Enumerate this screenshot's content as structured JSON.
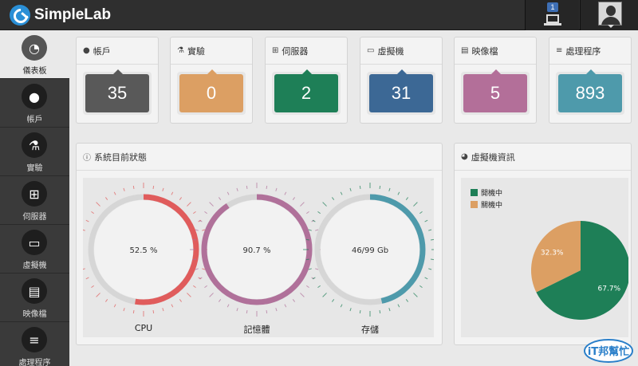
{
  "app": {
    "name": "SimpleLab"
  },
  "topbar": {
    "notification_count": "1",
    "vm_icon": "laptop-icon",
    "user_icon": "user-avatar"
  },
  "sidebar": {
    "items": [
      {
        "label": "儀表板",
        "icon": "dashboard-icon",
        "glyph": "◔",
        "active": true
      },
      {
        "label": "帳戶",
        "icon": "user-icon",
        "glyph": "●"
      },
      {
        "label": "實驗",
        "icon": "flask-icon",
        "glyph": "⚗"
      },
      {
        "label": "伺服器",
        "icon": "sitemap-icon",
        "glyph": "⊞"
      },
      {
        "label": "虛擬機",
        "icon": "laptop-icon",
        "glyph": "▭"
      },
      {
        "label": "映像檔",
        "icon": "hdd-icon",
        "glyph": "▤"
      },
      {
        "label": "處理程序",
        "icon": "server-icon",
        "glyph": "≡"
      }
    ]
  },
  "stats": [
    {
      "title": "帳戶",
      "value": "35",
      "color": "#595959",
      "icon": "user-icon",
      "glyph": "●"
    },
    {
      "title": "實驗",
      "value": "0",
      "color": "#dc9f63",
      "icon": "flask-icon",
      "glyph": "⚗"
    },
    {
      "title": "伺服器",
      "value": "2",
      "color": "#1e7f57",
      "icon": "sitemap-icon",
      "glyph": "⊞"
    },
    {
      "title": "虛擬機",
      "value": "31",
      "color": "#3c6895",
      "icon": "laptop-icon",
      "glyph": "▭"
    },
    {
      "title": "映像檔",
      "value": "5",
      "color": "#b36f99",
      "icon": "hdd-icon",
      "glyph": "▤"
    },
    {
      "title": "處理程序",
      "value": "893",
      "color": "#4e9aab",
      "icon": "server-icon",
      "glyph": "≡"
    }
  ],
  "system_status": {
    "title": "系統目前狀態",
    "icon": "info-icon",
    "gauges": [
      {
        "label": "CPU",
        "text": "52.5 %",
        "fraction": 0.525,
        "color": "#e05c5c",
        "tick_color": "#e05c5c"
      },
      {
        "label": "記憶體",
        "text": "90.7 %",
        "fraction": 0.907,
        "color": "#b0719a",
        "tick_color": "#b0719a"
      },
      {
        "label": "存儲",
        "text": "46/99 Gb",
        "fraction": 0.4646,
        "color": "#4e9aab",
        "tick_color": "#1e7f57"
      }
    ]
  },
  "vm_info": {
    "title": "虛擬機資訊",
    "icon": "pie-chart-icon",
    "legend": [
      {
        "label": "開機中",
        "color": "#1e7f57"
      },
      {
        "label": "關機中",
        "color": "#dc9f63"
      }
    ],
    "slices": [
      {
        "label": "67.7%",
        "value": 67.7,
        "color": "#1e7f57"
      },
      {
        "label": "32.3%",
        "value": 32.3,
        "color": "#dc9f63"
      }
    ]
  },
  "watermark": {
    "text": "iT邦幫忙"
  }
}
